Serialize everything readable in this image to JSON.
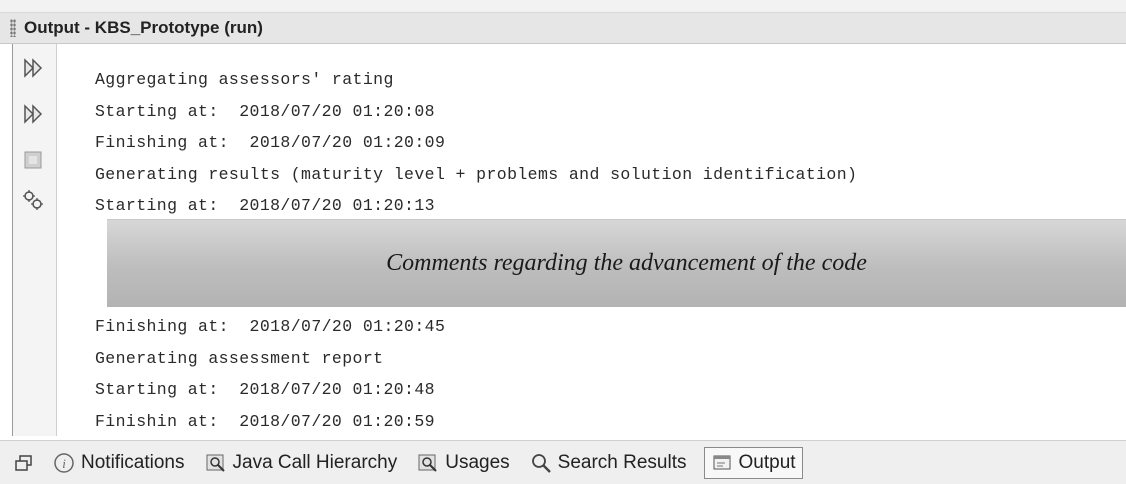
{
  "window": {
    "title": "Output - KBS_Prototype (run)"
  },
  "toolbar_icons": [
    "rerun-icon",
    "rerun-with-params-icon",
    "stop-icon",
    "settings-icon"
  ],
  "output": {
    "lines_before": [
      "Aggregating assessors' rating",
      "Starting at:  2018/07/20 01:20:08",
      "Finishing at:  2018/07/20 01:20:09",
      "Generating results (maturity level + problems and solution identification)",
      "Starting at:  2018/07/20 01:20:13"
    ],
    "comment": "Comments regarding the advancement of the code",
    "lines_after": [
      "Finishing at:  2018/07/20 01:20:45",
      "Generating assessment report",
      "Starting at:  2018/07/20 01:20:48",
      "Finishin at:  2018/07/20 01:20:59"
    ]
  },
  "bottom_tabs": [
    {
      "label": "Notifications",
      "icon": "info-icon"
    },
    {
      "label": "Java Call Hierarchy",
      "icon": "call-hierarchy-icon"
    },
    {
      "label": "Usages",
      "icon": "usages-icon"
    },
    {
      "label": "Search Results",
      "icon": "search-icon"
    },
    {
      "label": "Output",
      "icon": "output-icon",
      "selected": true
    }
  ],
  "colors": {
    "comment_box": "#bdbdbd",
    "titlebar": "#e6e6e6"
  }
}
